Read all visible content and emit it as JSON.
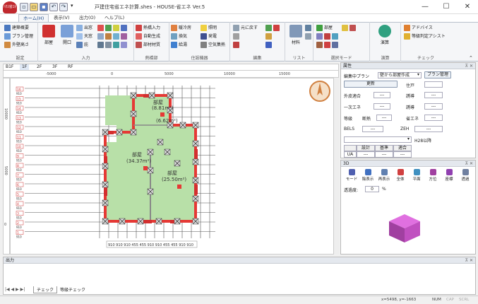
{
  "window": {
    "title": "戸建住宅省エネ計算.shes - HOUSE-省エネ Ver.5",
    "logo_text": "ﾊｳｽ省ｴﾈ",
    "qa_icons": [
      "new-file-icon",
      "open-folder-icon",
      "save-icon",
      "undo-icon",
      "redo-icon"
    ],
    "controls": {
      "minimize": "—",
      "maximize": "☐",
      "close": "✕"
    }
  },
  "ribbon": {
    "tabs": [
      {
        "label": "ホーム(H)",
        "active": true
      },
      {
        "label": "表示(V)",
        "active": false
      },
      {
        "label": "出力(O)",
        "active": false
      },
      {
        "label": "ヘルプ(L)",
        "active": false
      }
    ],
    "groups": [
      {
        "label": "設定",
        "items": [
          "建築概要",
          "プラン管理",
          "外壁高さ"
        ]
      },
      {
        "label": "入力",
        "items": [
          "部屋",
          "開口",
          "出窓",
          "天窓",
          "庇"
        ]
      },
      {
        "label": "熱橋部",
        "items": [
          "熱橋入力",
          "自動生成",
          "部材材質"
        ]
      },
      {
        "label": "住設機器",
        "items": [
          "暖冷房",
          "照明",
          "換気",
          "給湯",
          "発電",
          "空気集熱"
        ]
      },
      {
        "label": "編集",
        "items": [
          "元に戻す"
        ]
      },
      {
        "label": "リスト",
        "items": [
          "材料"
        ]
      },
      {
        "label": "選択モード",
        "items": [
          "部屋"
        ]
      },
      {
        "label": "演算",
        "items": [
          "演算"
        ]
      },
      {
        "label": "チェック",
        "items": [
          "アドバイス",
          "等級判定アシスト"
        ]
      }
    ]
  },
  "floor_tabs": [
    "B1F",
    "1F",
    "2F",
    "3F",
    "RF"
  ],
  "ruler": {
    "top_ticks": [
      "-5000",
      "0",
      "5000",
      "10000",
      "15000"
    ],
    "left_ticks": [
      "10000",
      "5000",
      "0"
    ],
    "axis_markers": [
      "16",
      "15",
      "14",
      "13",
      "12",
      "11",
      "10",
      "9",
      "8",
      "7",
      "6",
      "5",
      "4",
      "3",
      "2",
      "1"
    ],
    "axis_sub": "910"
  },
  "plan": {
    "rooms": [
      {
        "name": "部屋",
        "area": "(34.37m²)"
      },
      {
        "name": "部屋",
        "area": "(25.50m²)"
      },
      {
        "name": "部屋",
        "area": "(8.81m²)"
      },
      {
        "name": "部屋",
        "area": "(6.62m²)"
      }
    ],
    "bottom_axis": "910 910 910 455 455 910 910 455 455 910 910"
  },
  "attributes": {
    "title": "属性",
    "plan_label": "編集中プラン",
    "plan_value": "壁から部屋作成",
    "plan_button": "プラン管理",
    "update_button": "更新",
    "standard": "住戸",
    "rows": [
      {
        "left": "外皮適合",
        "lval": "---",
        "right": "誘導",
        "rval": "---"
      },
      {
        "left": "一次エネ",
        "lval": "---",
        "right": "誘導",
        "rval": "---"
      },
      {
        "left": "等級",
        "mid": "断熱",
        "lval": "---",
        "right": "省エネ",
        "rval": "---"
      }
    ],
    "bels": "BELS",
    "bels_val": "---",
    "zeh": "ZEH",
    "zeh_val": "---",
    "select_value": "H28以降",
    "table_headers": [
      "",
      "設計",
      "基準",
      "適合"
    ],
    "table_row": [
      "UA",
      "---",
      "---",
      "---"
    ]
  },
  "view3d": {
    "title": "3D",
    "tools": [
      "モード",
      "陰表示",
      "再表示",
      "全体",
      "平面",
      "方位",
      "座標",
      "透過"
    ],
    "transparency_label": "透過度:",
    "transparency_value": "0",
    "transparency_unit": "%"
  },
  "output": {
    "title": "出力",
    "tabs": [
      "チェック",
      "等級チェック"
    ]
  },
  "status": {
    "coords": "x=5498, y=-1663",
    "indicators": [
      "NUM",
      "CAP",
      "SCRL"
    ]
  },
  "colors": {
    "accent": "#1a4a8a",
    "wall": "#e53935",
    "room": "#b8e0a8",
    "ribbon_bg": "#f5f6f8",
    "model": "#c050c0"
  }
}
